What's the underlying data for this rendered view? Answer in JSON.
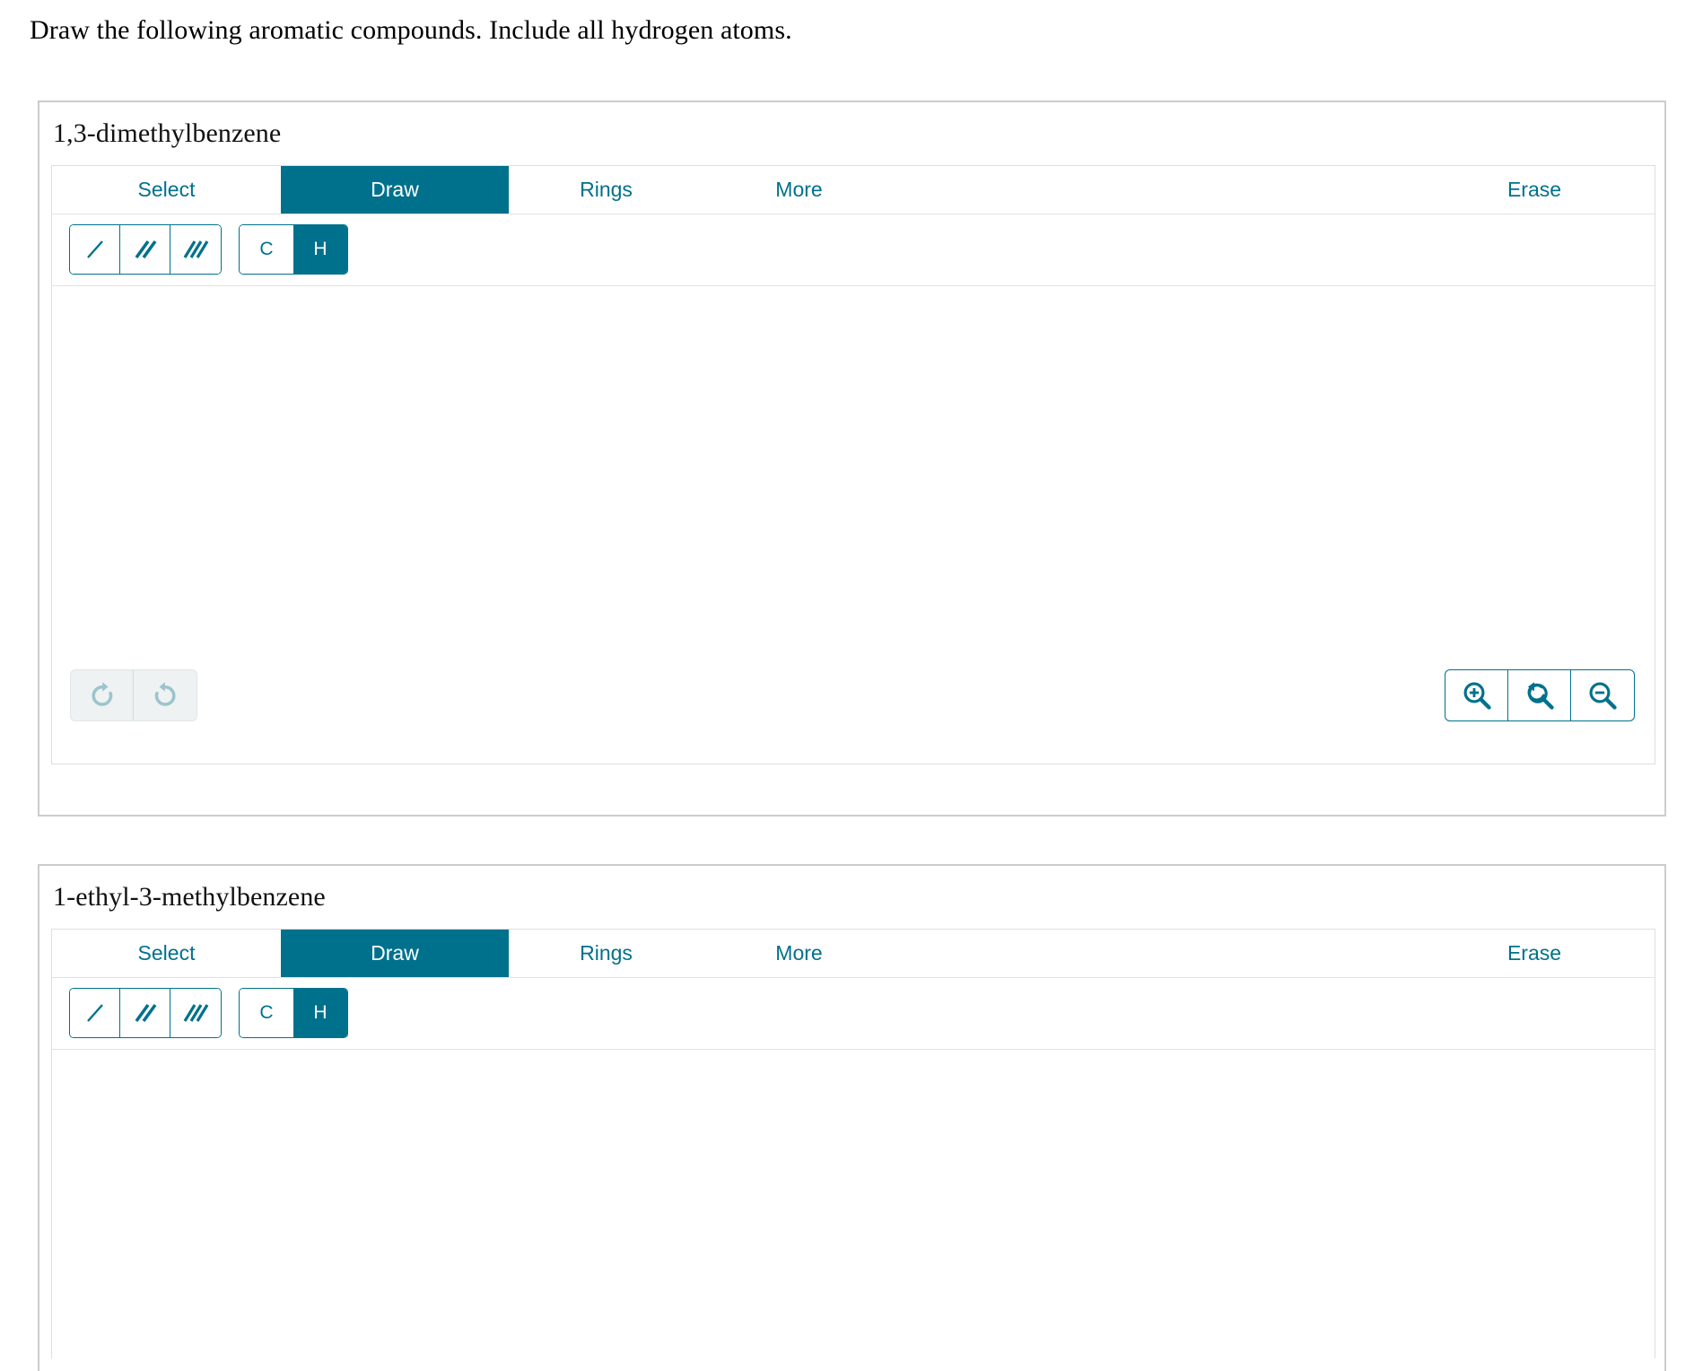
{
  "prompt": {
    "text": "Draw the following aromatic compounds. Include all hydrogen atoms."
  },
  "colors": {
    "accent_teal": "#00718c",
    "panel_border": "#cccccc",
    "inner_border": "#dedede",
    "disabled_bg": "#eef2f2",
    "disabled_icon": "#9cc4cd"
  },
  "editors": [
    {
      "title": "1,3-dimethylbenzene",
      "tabs": [
        {
          "label": "Select",
          "active": false
        },
        {
          "label": "Draw",
          "active": true
        },
        {
          "label": "Rings",
          "active": false
        },
        {
          "label": "More",
          "active": false
        },
        {
          "label": "Erase",
          "active": false
        }
      ],
      "bond_tools": [
        {
          "icon": "single-bond-icon",
          "active": false
        },
        {
          "icon": "double-bond-icon",
          "active": false
        },
        {
          "icon": "triple-bond-icon",
          "active": false
        }
      ],
      "atom_tools": [
        {
          "label": "C",
          "active": false
        },
        {
          "label": "H",
          "active": true
        }
      ],
      "history_controls": [
        {
          "icon": "redo-icon",
          "enabled": false
        },
        {
          "icon": "undo-icon",
          "enabled": false
        }
      ],
      "zoom_controls": [
        {
          "icon": "zoom-in-icon",
          "enabled": true
        },
        {
          "icon": "zoom-reset-icon",
          "enabled": true
        },
        {
          "icon": "zoom-out-icon",
          "enabled": true
        }
      ],
      "canvas_content": ""
    },
    {
      "title": "1-ethyl-3-methylbenzene",
      "tabs": [
        {
          "label": "Select",
          "active": false
        },
        {
          "label": "Draw",
          "active": true
        },
        {
          "label": "Rings",
          "active": false
        },
        {
          "label": "More",
          "active": false
        },
        {
          "label": "Erase",
          "active": false
        }
      ],
      "bond_tools": [
        {
          "icon": "single-bond-icon",
          "active": false
        },
        {
          "icon": "double-bond-icon",
          "active": false
        },
        {
          "icon": "triple-bond-icon",
          "active": false
        }
      ],
      "atom_tools": [
        {
          "label": "C",
          "active": false
        },
        {
          "label": "H",
          "active": true
        }
      ],
      "canvas_content": ""
    }
  ]
}
